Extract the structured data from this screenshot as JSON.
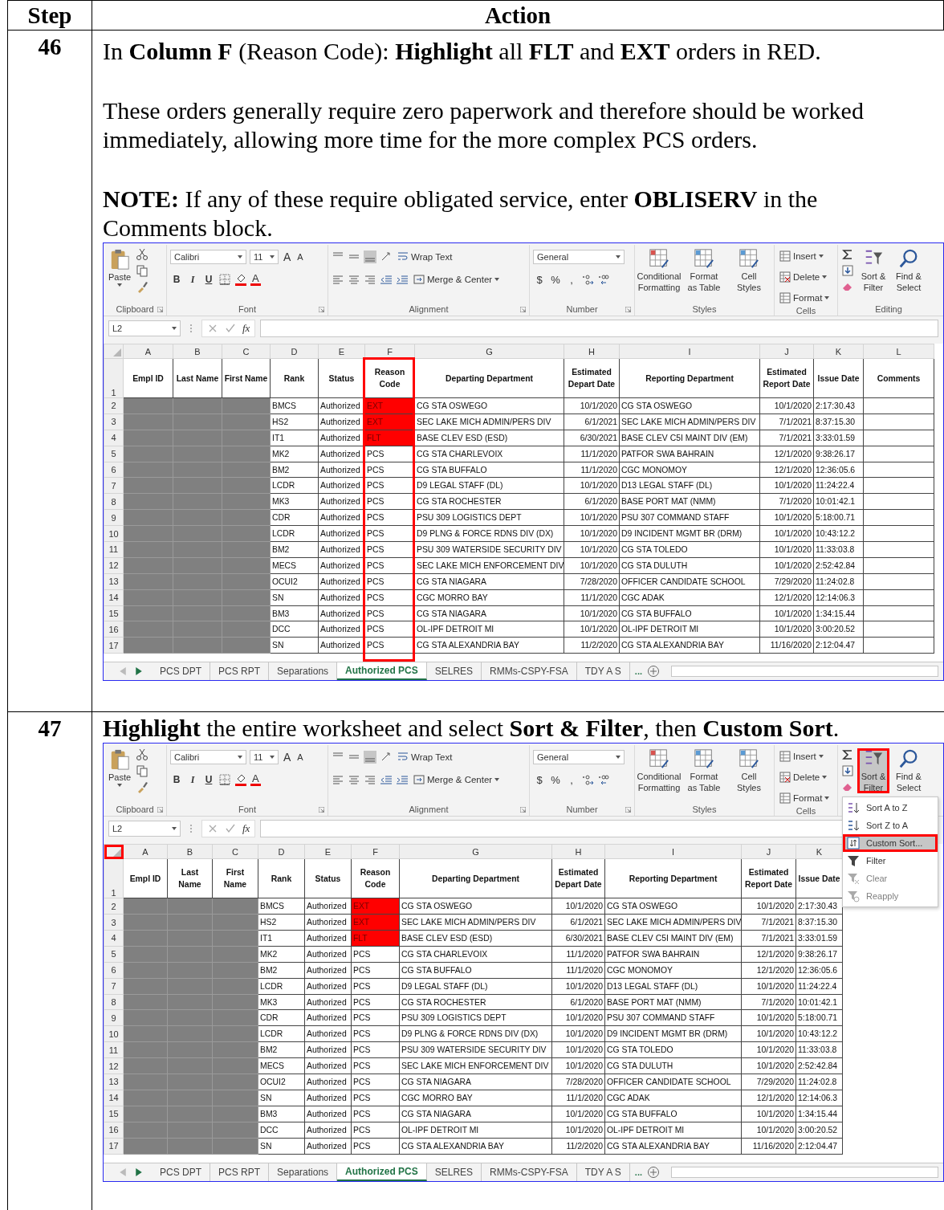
{
  "table": {
    "columns": [
      "Step",
      "Action"
    ]
  },
  "steps": [
    {
      "number": "46",
      "paragraphs": [
        "In **Column F** (Reason Code):  **Highlight** all **FLT** and **EXT** orders in RED.",
        "These orders generally require zero paperwork and therefore should be worked immediately, allowing more time for the more complex PCS orders.",
        "**NOTE:**  If any of these require obligated service, enter **OBLISERV** in the Comments block."
      ],
      "screen": {
        "ribbon": {
          "paste": "Paste",
          "clipboard": "Clipboard",
          "font_family": "Calibri",
          "font_size": "11",
          "grow": "A",
          "shrink": "A",
          "styles_buttons": [
            "B",
            "I",
            "U"
          ],
          "color_letter": "A",
          "font": "Font",
          "wrap": "Wrap Text",
          "merge": "Merge & Center",
          "alignment": "Alignment",
          "number_format": "General",
          "symbols": [
            "$",
            "%",
            ","
          ],
          "number": "Number",
          "style_items": [
            "Conditional Formatting",
            "Format as Table",
            "Cell Styles"
          ],
          "styles": "Styles",
          "cell_items": [
            "Insert",
            "Delete",
            "Format"
          ],
          "cells": "Cells",
          "sort_filter": {
            "label": "Sort & Filter",
            "outlined": false
          },
          "find_select": "Find & Select",
          "editing": "Editing"
        },
        "name_box": "L2",
        "fx": "fx",
        "corner_outlined": false,
        "header_row": "1",
        "columns": [
          {
            "letter": "A",
            "title": "Empl ID",
            "kind": "redacted",
            "outlined": false
          },
          {
            "letter": "B",
            "title": "Last Name",
            "kind": "redacted",
            "outlined": false
          },
          {
            "letter": "C",
            "title": "First Name",
            "kind": "redacted",
            "outlined": false
          },
          {
            "letter": "D",
            "title": "Rank",
            "kind": "text",
            "outlined": false
          },
          {
            "letter": "E",
            "title": "Status",
            "kind": "text",
            "outlined": false
          },
          {
            "letter": "F",
            "title": "Reason Code",
            "kind": "code",
            "outlined": true
          },
          {
            "letter": "G",
            "title": "Departing Department",
            "kind": "text",
            "outlined": false
          },
          {
            "letter": "H",
            "title": "Estimated Depart Date",
            "kind": "date",
            "outlined": false
          },
          {
            "letter": "I",
            "title": "Reporting Department",
            "kind": "text",
            "outlined": false
          },
          {
            "letter": "J",
            "title": "Estimated Report Date",
            "kind": "date",
            "outlined": false
          },
          {
            "letter": "K",
            "title": "Issue Date",
            "kind": "text",
            "outlined": false
          },
          {
            "letter": "L",
            "title": "Comments",
            "kind": "blank",
            "outlined": false
          }
        ],
        "rows": [
          {
            "n": "2",
            "highlighted": true,
            "cells": [
              "",
              "",
              "",
              "BMCS",
              "Authorized",
              "EXT",
              "CG STA OSWEGO",
              "10/1/2020",
              "CG STA OSWEGO",
              "10/1/2020",
              "2:17:30.43",
              ""
            ]
          },
          {
            "n": "3",
            "highlighted": true,
            "cells": [
              "",
              "",
              "",
              "HS2",
              "Authorized",
              "EXT",
              "SEC LAKE MICH ADMIN/PERS DIV",
              "6/1/2021",
              "SEC LAKE MICH ADMIN/PERS DIV",
              "7/1/2021",
              "8:37:15.30",
              ""
            ]
          },
          {
            "n": "4",
            "highlighted": true,
            "cells": [
              "",
              "",
              "",
              "IT1",
              "Authorized",
              "FLT",
              "BASE CLEV ESD (ESD)",
              "6/30/2021",
              "BASE CLEV C5I MAINT DIV (EM)",
              "7/1/2021",
              "3:33:01.59",
              ""
            ]
          },
          {
            "n": "5",
            "highlighted": false,
            "cells": [
              "",
              "",
              "",
              "MK2",
              "Authorized",
              "PCS",
              "CG STA CHARLEVOIX",
              "11/1/2020",
              "PATFOR SWA BAHRAIN",
              "12/1/2020",
              "9:38:26.17",
              ""
            ]
          },
          {
            "n": "6",
            "highlighted": false,
            "cells": [
              "",
              "",
              "",
              "BM2",
              "Authorized",
              "PCS",
              "CG STA BUFFALO",
              "11/1/2020",
              "CGC MONOMOY",
              "12/1/2020",
              "12:36:05.6",
              ""
            ]
          },
          {
            "n": "7",
            "highlighted": false,
            "cells": [
              "",
              "",
              "",
              "LCDR",
              "Authorized",
              "PCS",
              "D9 LEGAL STAFF (DL)",
              "10/1/2020",
              "D13 LEGAL STAFF (DL)",
              "10/1/2020",
              "11:24:22.4",
              ""
            ]
          },
          {
            "n": "8",
            "highlighted": false,
            "cells": [
              "",
              "",
              "",
              "MK3",
              "Authorized",
              "PCS",
              "CG STA ROCHESTER",
              "6/1/2020",
              "BASE PORT MAT (NMM)",
              "7/1/2020",
              "10:01:42.1",
              ""
            ]
          },
          {
            "n": "9",
            "highlighted": false,
            "cells": [
              "",
              "",
              "",
              "CDR",
              "Authorized",
              "PCS",
              "PSU 309 LOGISTICS DEPT",
              "10/1/2020",
              "PSU 307 COMMAND STAFF",
              "10/1/2020",
              "5:18:00.71",
              ""
            ]
          },
          {
            "n": "10",
            "highlighted": false,
            "cells": [
              "",
              "",
              "",
              "LCDR",
              "Authorized",
              "PCS",
              "D9 PLNG & FORCE RDNS DIV (DX)",
              "10/1/2020",
              "D9 INCIDENT MGMT BR (DRM)",
              "10/1/2020",
              "10:43:12.2",
              ""
            ]
          },
          {
            "n": "11",
            "highlighted": false,
            "cells": [
              "",
              "",
              "",
              "BM2",
              "Authorized",
              "PCS",
              "PSU 309 WATERSIDE SECURITY DIV",
              "10/1/2020",
              "CG STA TOLEDO",
              "10/1/2020",
              "11:33:03.8",
              ""
            ]
          },
          {
            "n": "12",
            "highlighted": false,
            "cells": [
              "",
              "",
              "",
              "MECS",
              "Authorized",
              "PCS",
              "SEC LAKE MICH ENFORCEMENT DIV",
              "10/1/2020",
              "CG STA DULUTH",
              "10/1/2020",
              "2:52:42.84",
              ""
            ]
          },
          {
            "n": "13",
            "highlighted": false,
            "cells": [
              "",
              "",
              "",
              "OCUI2",
              "Authorized",
              "PCS",
              "CG STA NIAGARA",
              "7/28/2020",
              "OFFICER CANDIDATE SCHOOL",
              "7/29/2020",
              "11:24:02.8",
              ""
            ]
          },
          {
            "n": "14",
            "highlighted": false,
            "cells": [
              "",
              "",
              "",
              "SN",
              "Authorized",
              "PCS",
              "CGC MORRO BAY",
              "11/1/2020",
              "CGC ADAK",
              "12/1/2020",
              "12:14:06.3",
              ""
            ]
          },
          {
            "n": "15",
            "highlighted": false,
            "cells": [
              "",
              "",
              "",
              "BM3",
              "Authorized",
              "PCS",
              "CG STA NIAGARA",
              "10/1/2020",
              "CG STA BUFFALO",
              "10/1/2020",
              "1:34:15.44",
              ""
            ]
          },
          {
            "n": "16",
            "highlighted": false,
            "cells": [
              "",
              "",
              "",
              "DCC",
              "Authorized",
              "PCS",
              "OL-IPF DETROIT MI",
              "10/1/2020",
              "OL-IPF DETROIT MI",
              "10/1/2020",
              "3:00:20.52",
              ""
            ]
          },
          {
            "n": "17",
            "highlighted": false,
            "cells": [
              "",
              "",
              "",
              "SN",
              "Authorized",
              "PCS",
              "CG STA ALEXANDRIA BAY",
              "11/2/2020",
              "CG STA ALEXANDRIA BAY",
              "11/16/2020",
              "2:12:04.47",
              ""
            ]
          }
        ],
        "tabs": [
          {
            "label": "PCS DPT",
            "selected": false
          },
          {
            "label": "PCS RPT",
            "selected": false
          },
          {
            "label": "Separations",
            "selected": false
          },
          {
            "label": "Authorized PCS",
            "selected": true
          },
          {
            "label": "SELRES",
            "selected": false
          },
          {
            "label": "RMMs-CSPY-FSA",
            "selected": false
          },
          {
            "label": "TDY A S",
            "selected": false
          }
        ],
        "more_tabs": "..."
      }
    },
    {
      "number": "47",
      "paragraphs": [
        "**Highlight** the entire worksheet and select **Sort & Filter**, then **Custom Sort**."
      ],
      "screen": {
        "ribbon": {
          "paste": "Paste",
          "clipboard": "Clipboard",
          "font_family": "Calibri",
          "font_size": "11",
          "grow": "A",
          "shrink": "A",
          "styles_buttons": [
            "B",
            "I",
            "U"
          ],
          "color_letter": "A",
          "font": "Font",
          "wrap": "Wrap Text",
          "merge": "Merge & Center",
          "alignment": "Alignment",
          "number_format": "General",
          "symbols": [
            "$",
            "%",
            ","
          ],
          "number": "Number",
          "style_items": [
            "Conditional Formatting",
            "Format as Table",
            "Cell Styles"
          ],
          "styles": "Styles",
          "cell_items": [
            "Insert",
            "Delete",
            "Format"
          ],
          "cells": "Cells",
          "sort_filter": {
            "label": "Sort & Filter",
            "outlined": true
          },
          "find_select": "Find & Select"
        },
        "name_box": "L2",
        "fx": "fx",
        "corner_outlined": true,
        "header_row": "1",
        "columns": [
          {
            "letter": "A",
            "title": "Empl ID",
            "kind": "redacted",
            "outlined": false
          },
          {
            "letter": "B",
            "title": "Last Name",
            "kind": "redacted",
            "outlined": false
          },
          {
            "letter": "C",
            "title": "First Name",
            "kind": "redacted",
            "outlined": false
          },
          {
            "letter": "D",
            "title": "Rank",
            "kind": "text",
            "outlined": false
          },
          {
            "letter": "E",
            "title": "Status",
            "kind": "text",
            "outlined": false
          },
          {
            "letter": "F",
            "title": "Reason Code",
            "kind": "code",
            "outlined": false
          },
          {
            "letter": "G",
            "title": "Departing Department",
            "kind": "text",
            "outlined": false
          },
          {
            "letter": "H",
            "title": "Estimated Depart Date",
            "kind": "date",
            "outlined": false
          },
          {
            "letter": "I",
            "title": "Reporting Department",
            "kind": "text",
            "outlined": false
          },
          {
            "letter": "J",
            "title": "Estimated Report Date",
            "kind": "date",
            "outlined": false
          },
          {
            "letter": "K",
            "title": "Issue Date",
            "kind": "text",
            "outlined": false
          }
        ],
        "rows": [
          {
            "n": "2",
            "highlighted": true,
            "cells": [
              "",
              "",
              "",
              "BMCS",
              "Authorized",
              "EXT",
              "CG STA OSWEGO",
              "10/1/2020",
              "CG STA OSWEGO",
              "10/1/2020",
              "2:17:30.43"
            ]
          },
          {
            "n": "3",
            "highlighted": true,
            "cells": [
              "",
              "",
              "",
              "HS2",
              "Authorized",
              "EXT",
              "SEC LAKE MICH ADMIN/PERS DIV",
              "6/1/2021",
              "SEC LAKE MICH ADMIN/PERS DIV",
              "7/1/2021",
              "8:37:15.30"
            ]
          },
          {
            "n": "4",
            "highlighted": true,
            "cells": [
              "",
              "",
              "",
              "IT1",
              "Authorized",
              "FLT",
              "BASE CLEV ESD (ESD)",
              "6/30/2021",
              "BASE CLEV C5I MAINT DIV (EM)",
              "7/1/2021",
              "3:33:01.59"
            ]
          },
          {
            "n": "5",
            "highlighted": false,
            "cells": [
              "",
              "",
              "",
              "MK2",
              "Authorized",
              "PCS",
              "CG STA CHARLEVOIX",
              "11/1/2020",
              "PATFOR SWA BAHRAIN",
              "12/1/2020",
              "9:38:26.17"
            ]
          },
          {
            "n": "6",
            "highlighted": false,
            "cells": [
              "",
              "",
              "",
              "BM2",
              "Authorized",
              "PCS",
              "CG STA BUFFALO",
              "11/1/2020",
              "CGC MONOMOY",
              "12/1/2020",
              "12:36:05.6"
            ]
          },
          {
            "n": "7",
            "highlighted": false,
            "cells": [
              "",
              "",
              "",
              "LCDR",
              "Authorized",
              "PCS",
              "D9 LEGAL STAFF (DL)",
              "10/1/2020",
              "D13 LEGAL STAFF (DL)",
              "10/1/2020",
              "11:24:22.4"
            ]
          },
          {
            "n": "8",
            "highlighted": false,
            "cells": [
              "",
              "",
              "",
              "MK3",
              "Authorized",
              "PCS",
              "CG STA ROCHESTER",
              "6/1/2020",
              "BASE PORT MAT (NMM)",
              "7/1/2020",
              "10:01:42.1"
            ]
          },
          {
            "n": "9",
            "highlighted": false,
            "cells": [
              "",
              "",
              "",
              "CDR",
              "Authorized",
              "PCS",
              "PSU 309 LOGISTICS DEPT",
              "10/1/2020",
              "PSU 307 COMMAND STAFF",
              "10/1/2020",
              "5:18:00.71"
            ]
          },
          {
            "n": "10",
            "highlighted": false,
            "cells": [
              "",
              "",
              "",
              "LCDR",
              "Authorized",
              "PCS",
              "D9 PLNG & FORCE RDNS DIV (DX)",
              "10/1/2020",
              "D9 INCIDENT MGMT BR (DRM)",
              "10/1/2020",
              "10:43:12.2"
            ]
          },
          {
            "n": "11",
            "highlighted": false,
            "cells": [
              "",
              "",
              "",
              "BM2",
              "Authorized",
              "PCS",
              "PSU 309 WATERSIDE SECURITY DIV",
              "10/1/2020",
              "CG STA TOLEDO",
              "10/1/2020",
              "11:33:03.8"
            ]
          },
          {
            "n": "12",
            "highlighted": false,
            "cells": [
              "",
              "",
              "",
              "MECS",
              "Authorized",
              "PCS",
              "SEC LAKE MICH ENFORCEMENT DIV",
              "10/1/2020",
              "CG STA DULUTH",
              "10/1/2020",
              "2:52:42.84"
            ]
          },
          {
            "n": "13",
            "highlighted": false,
            "cells": [
              "",
              "",
              "",
              "OCUI2",
              "Authorized",
              "PCS",
              "CG STA NIAGARA",
              "7/28/2020",
              "OFFICER CANDIDATE SCHOOL",
              "7/29/2020",
              "11:24:02.8"
            ]
          },
          {
            "n": "14",
            "highlighted": false,
            "cells": [
              "",
              "",
              "",
              "SN",
              "Authorized",
              "PCS",
              "CGC MORRO BAY",
              "11/1/2020",
              "CGC ADAK",
              "12/1/2020",
              "12:14:06.3"
            ]
          },
          {
            "n": "15",
            "highlighted": false,
            "cells": [
              "",
              "",
              "",
              "BM3",
              "Authorized",
              "PCS",
              "CG STA NIAGARA",
              "10/1/2020",
              "CG STA BUFFALO",
              "10/1/2020",
              "1:34:15.44"
            ]
          },
          {
            "n": "16",
            "highlighted": false,
            "cells": [
              "",
              "",
              "",
              "DCC",
              "Authorized",
              "PCS",
              "OL-IPF DETROIT MI",
              "10/1/2020",
              "OL-IPF DETROIT MI",
              "10/1/2020",
              "3:00:20.52"
            ]
          },
          {
            "n": "17",
            "highlighted": false,
            "cells": [
              "",
              "",
              "",
              "SN",
              "Authorized",
              "PCS",
              "CG STA ALEXANDRIA BAY",
              "11/2/2020",
              "CG STA ALEXANDRIA BAY",
              "11/16/2020",
              "2:12:04.47"
            ]
          }
        ],
        "tabs": [
          {
            "label": "PCS DPT",
            "selected": false
          },
          {
            "label": "PCS RPT",
            "selected": false
          },
          {
            "label": "Separations",
            "selected": false
          },
          {
            "label": "Authorized PCS",
            "selected": true
          },
          {
            "label": "SELRES",
            "selected": false
          },
          {
            "label": "RMMs-CSPY-FSA",
            "selected": false
          },
          {
            "label": "TDY A S",
            "selected": false
          }
        ],
        "more_tabs": "...",
        "menu": {
          "items": [
            {
              "label": "Sort A to Z",
              "kind": "sort-up",
              "selected": false,
              "disabled": false,
              "outlined": false
            },
            {
              "label": "Sort Z to A",
              "kind": "sort-down",
              "selected": false,
              "disabled": false,
              "outlined": false
            },
            {
              "label": "Custom Sort...",
              "kind": "custom",
              "selected": true,
              "disabled": false,
              "outlined": true
            },
            {
              "label": "Filter",
              "kind": "filter",
              "selected": false,
              "disabled": false,
              "outlined": false
            },
            {
              "label": "Clear",
              "kind": "clear",
              "selected": false,
              "disabled": true,
              "outlined": false
            },
            {
              "label": "Reapply",
              "kind": "reapply",
              "selected": false,
              "disabled": true,
              "outlined": false
            }
          ]
        }
      }
    }
  ]
}
